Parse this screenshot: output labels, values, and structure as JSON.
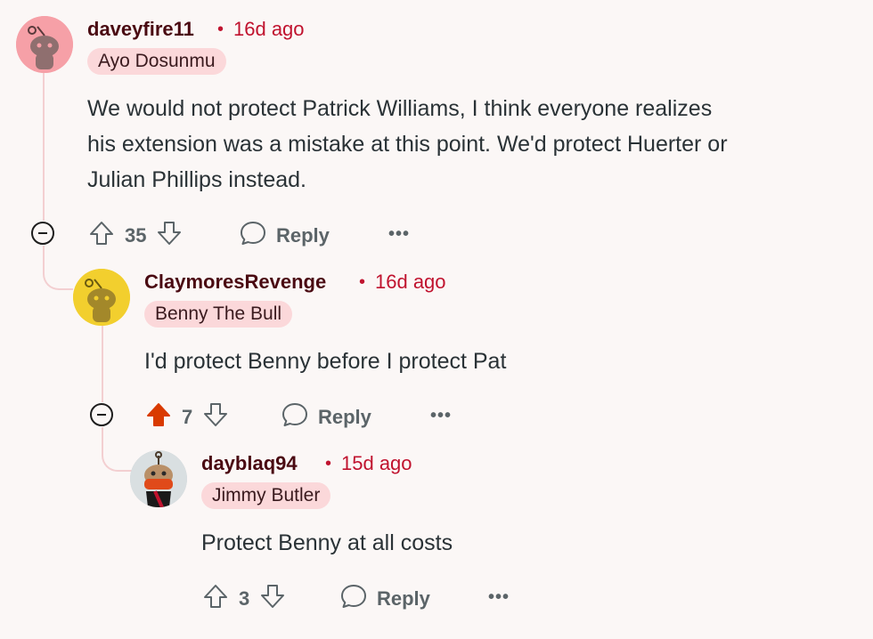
{
  "comments": [
    {
      "username": "daveyfire11",
      "separator": "•",
      "time": "16d ago",
      "flair": "Ayo Dosunmu",
      "body": "We would not protect Patrick Williams, I think everyone realizes his extension was a mistake at this point. We'd protect Huerter or Julian Phillips instead.",
      "body_lines": [
        "We would not protect Patrick Williams, I think everyone realizes",
        "his extension was a mistake at this point. We'd protect Huerter or",
        "Julian Phillips instead."
      ],
      "score": "35",
      "reply_label": "Reply",
      "more": "•••",
      "avatar_color": "#f6a0a7"
    },
    {
      "username": "ClaymoresRevenge",
      "separator": "•",
      "time": "16d ago",
      "flair": "Benny The Bull",
      "body": "I'd protect Benny before I protect Pat",
      "score": "7",
      "upvoted": true,
      "reply_label": "Reply",
      "more": "•••",
      "avatar_color": "#f2cf2e"
    },
    {
      "username": "dayblaq94",
      "separator": "•",
      "time": "15d ago",
      "flair": "Jimmy Butler",
      "body": "Protect Benny at all costs",
      "score": "3",
      "reply_label": "Reply",
      "more": "•••",
      "avatar_color": "#c7d0d3"
    }
  ],
  "colors": {
    "background": "#fbf7f6",
    "username": "#4a0a12",
    "time": "#c0122e",
    "flair_bg": "#fbd8da",
    "upvote_active": "#d93a00",
    "thread_line": "#f3cfd1"
  }
}
